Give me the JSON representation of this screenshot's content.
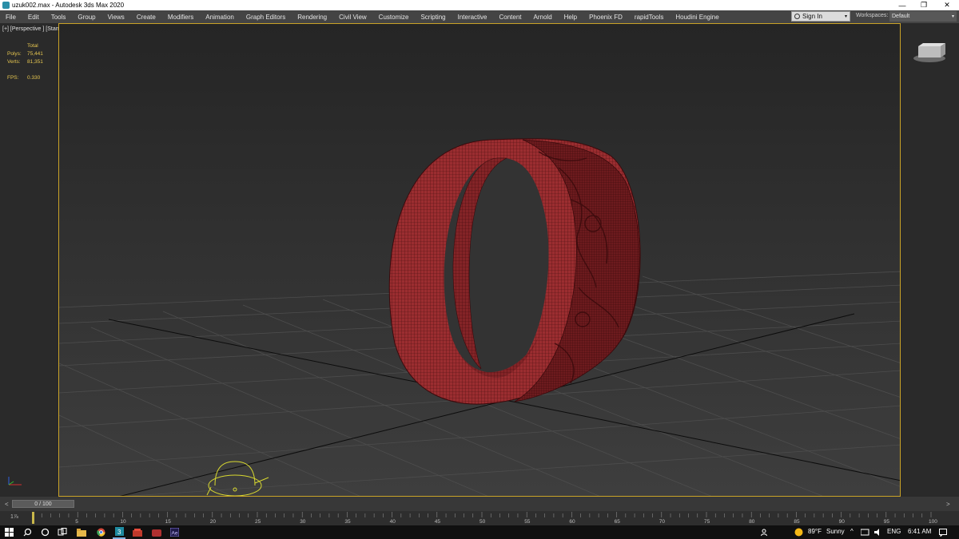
{
  "titlebar": {
    "title": "uzuk002.max - Autodesk 3ds Max 2020",
    "minimize_glyph": "—",
    "maximize_glyph": "❐",
    "close_glyph": "✕"
  },
  "menubar": {
    "items": [
      "File",
      "Edit",
      "Tools",
      "Group",
      "Views",
      "Create",
      "Modifiers",
      "Animation",
      "Graph Editors",
      "Rendering",
      "Civil View",
      "Customize",
      "Scripting",
      "Interactive",
      "Content",
      "Arnold",
      "Help",
      "Phoenix FD",
      "rapidTools",
      "Houdini Engine"
    ],
    "sign_in": "Sign In",
    "workspaces_label": "Workspaces:",
    "workspace_value": "Default",
    "dropdown_glyph": "▾"
  },
  "viewport": {
    "label": "[+] [Perspective ] [Standard ] [Clay + Edged Faces ]",
    "stats": {
      "total_label": "Total",
      "polys_label": "Polys:",
      "polys_value": "75,441",
      "verts_label": "Verts:",
      "verts_value": "81,351",
      "fps_label": "FPS:",
      "fps_value": "0.330"
    },
    "ring_color": "#9b2d30",
    "wire_color": "#4a0e10"
  },
  "timeslider": {
    "left_arrow": "<",
    "right_arrow": ">",
    "position_text": "0 / 100"
  },
  "trackbar": {
    "ticks": [
      "0",
      "5",
      "10",
      "15",
      "20",
      "25",
      "30",
      "35",
      "40",
      "45",
      "50",
      "55",
      "60",
      "65",
      "70",
      "75",
      "80",
      "85",
      "90",
      "95",
      "100"
    ],
    "frame_label": "1⅞"
  },
  "taskbar": {
    "weather_temp": "89°F",
    "weather_text": "Sunny",
    "language": "ENG",
    "time": "6:41 AM",
    "icons": [
      "windows-icon",
      "search-icon",
      "cortana-icon",
      "task-view-icon",
      "file-explorer-icon",
      "chrome-icon",
      "3dsmax-icon",
      "app-icon-red-1",
      "app-icon-red-2",
      "after-effects-icon"
    ]
  }
}
